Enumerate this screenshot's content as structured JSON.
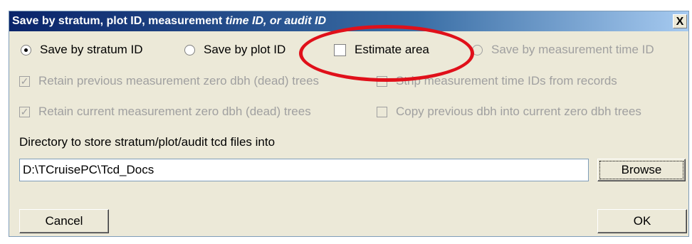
{
  "dialog": {
    "title_main": "Save by stratum, plot ID, measurement ",
    "title_italic": "time ID, or audit ID",
    "close_label": "X"
  },
  "save_options": {
    "stratum": {
      "label": "Save by stratum ID",
      "checked": true
    },
    "plot": {
      "label": "Save by plot ID",
      "checked": false
    },
    "estimate_area": {
      "label": "Estimate area",
      "checked": false
    },
    "measurement_time": {
      "label": "Save by measurement time ID",
      "checked": false,
      "disabled": true
    }
  },
  "checkboxes": {
    "retain_previous": {
      "label": "Retain previous measurement zero dbh (dead) trees",
      "checked": true,
      "disabled": true
    },
    "strip_time_ids": {
      "label": "Strip measurement time IDs from records",
      "checked": false,
      "disabled": true
    },
    "retain_current": {
      "label": "Retain current measurement zero dbh (dead) trees",
      "checked": true,
      "disabled": true
    },
    "copy_previous": {
      "label": "Copy previous dbh into current zero dbh trees",
      "checked": false,
      "disabled": true
    }
  },
  "directory": {
    "label": "Directory to store stratum/plot/audit tcd files into",
    "value": "D:\\TCruisePC\\Tcd_Docs"
  },
  "buttons": {
    "browse": "Browse",
    "cancel": "Cancel",
    "ok": "OK"
  },
  "annotation": {
    "color": "#e0101a"
  },
  "checkmark_glyph": "✓"
}
